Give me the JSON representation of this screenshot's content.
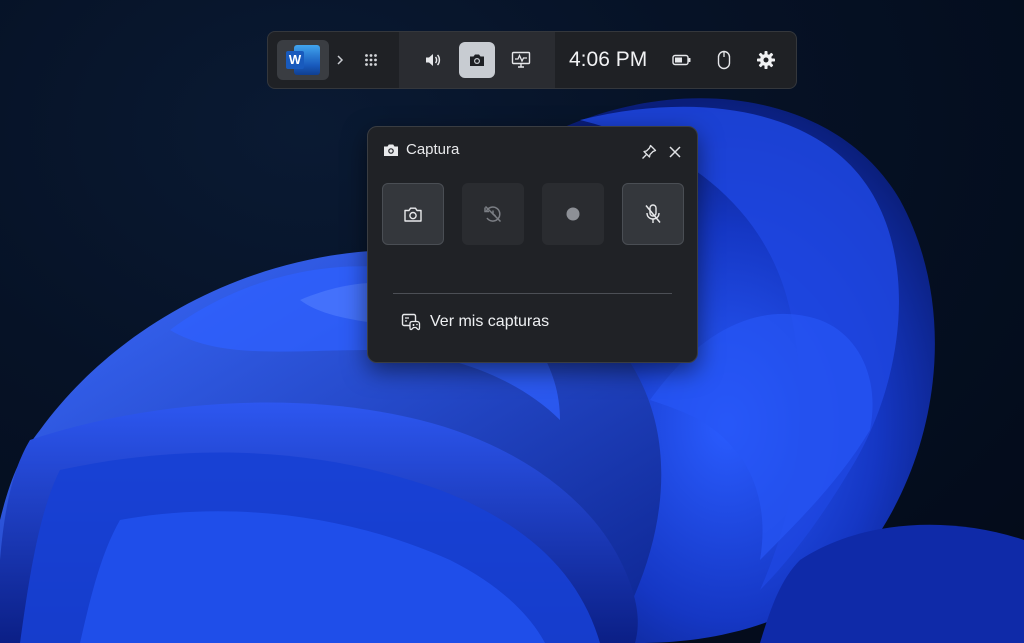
{
  "gamebar": {
    "app_icon": "word-icon",
    "app_letter": "W",
    "expand_icon": "chevron-right-icon",
    "widget_menu_icon": "grid-icon",
    "widgets": [
      {
        "name": "audio",
        "icon": "speaker-icon",
        "active": false
      },
      {
        "name": "capture",
        "icon": "camera-icon",
        "active": true
      },
      {
        "name": "performance",
        "icon": "performance-monitor-icon",
        "active": false
      }
    ],
    "time": "4:06 PM",
    "battery_icon": "battery-icon",
    "mouse_icon": "mouse-icon",
    "settings_icon": "gear-icon"
  },
  "capture_panel": {
    "title_icon": "camera-icon",
    "title": "Captura",
    "pin_icon": "pin-icon",
    "close_icon": "close-icon",
    "buttons": [
      {
        "name": "screenshot",
        "icon": "camera-icon",
        "enabled": true
      },
      {
        "name": "record-last",
        "icon": "record-last-icon",
        "enabled": false
      },
      {
        "name": "start-recording",
        "icon": "record-dot-icon",
        "enabled": false
      },
      {
        "name": "microphone",
        "icon": "microphone-off-icon",
        "enabled": true
      }
    ],
    "gallery_icon": "gallery-icon",
    "gallery_label": "Ver mis capturas"
  },
  "colors": {
    "bar_bg": "#1f2125",
    "panel_bg": "#202226",
    "accent_wallpaper": "#1a3fd6"
  }
}
